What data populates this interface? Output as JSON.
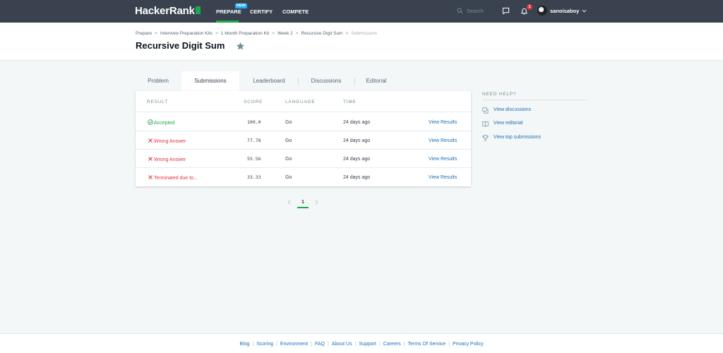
{
  "nav": {
    "logo": "HackerRank",
    "prepare": "PREPARE",
    "new_badge": "NEW",
    "certify": "CERTIFY",
    "compete": "COMPETE",
    "search_placeholder": "Search",
    "notification_count": "1",
    "username": "sanoisaboy"
  },
  "breadcrumb": [
    "Prepare",
    "Interview Preparation Kits",
    "1 Month Preparation Kit",
    "Week 2",
    "Recursive Digit Sum",
    "Submissions"
  ],
  "page_title": "Recursive Digit Sum",
  "tabs": [
    "Problem",
    "Submissions",
    "Leaderboard",
    "Discussions",
    "Editorial"
  ],
  "active_tab": "Submissions",
  "table": {
    "headers": [
      "RESULT",
      "SCORE",
      "LANGUAGE",
      "TIME"
    ],
    "rows": [
      {
        "result": "Accepted",
        "status": "ok",
        "score": "100.0",
        "language": "Go",
        "time": "24 days ago",
        "action": "View Results"
      },
      {
        "result": "Wrong Answer",
        "status": "bad",
        "score": "77.78",
        "language": "Go",
        "time": "24 days ago",
        "action": "View Results"
      },
      {
        "result": "Wrong Answer",
        "status": "bad",
        "score": "55.56",
        "language": "Go",
        "time": "24 days ago",
        "action": "View Results"
      },
      {
        "result": "Terminated due to...",
        "status": "bad",
        "score": "33.33",
        "language": "Go",
        "time": "24 days ago",
        "action": "View Results"
      }
    ]
  },
  "pagination": {
    "current": "1"
  },
  "help": {
    "title": "NEED HELP?",
    "items": [
      {
        "label": "View discussions",
        "icon": "discussion-icon"
      },
      {
        "label": "View editorial",
        "icon": "book-icon"
      },
      {
        "label": "View top submissions",
        "icon": "trophy-icon"
      }
    ]
  },
  "footer": [
    "Blog",
    "Scoring",
    "Environment",
    "FAQ",
    "About Us",
    "Support",
    "Careers",
    "Terms Of Service",
    "Privacy Policy"
  ],
  "colors": {
    "nav_bg": "#39424e",
    "accent_green": "#1ba94c",
    "error_red": "#e6333d",
    "link_blue": "#1d6fb7",
    "page_bg": "#f3f7f7",
    "new_badge": "#1cb0ff"
  }
}
